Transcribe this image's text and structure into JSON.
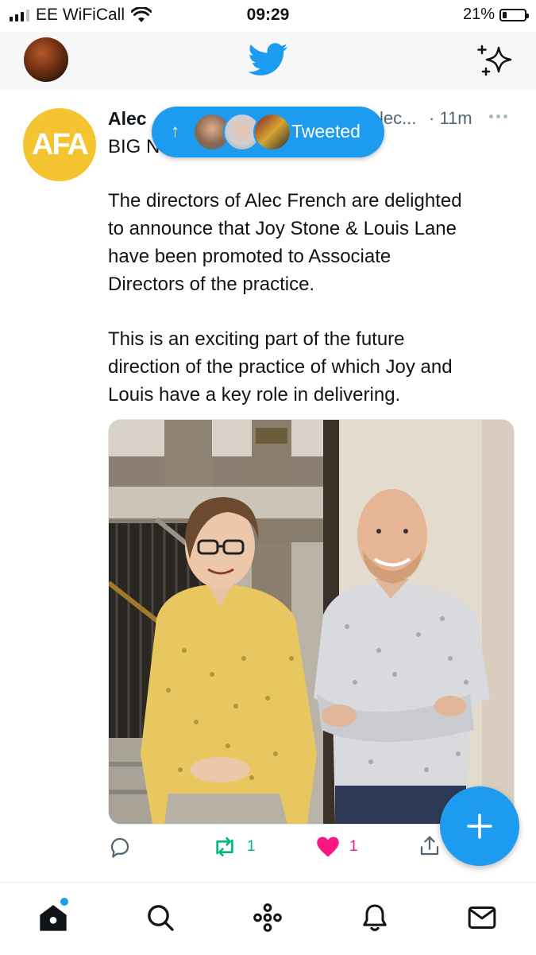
{
  "status_bar": {
    "carrier": "EE WiFiCall",
    "time": "09:29",
    "battery": "21%",
    "battery_level": 0.21
  },
  "header": {
    "logo_icon": "twitter-bird-icon",
    "sparkle_icon": "sparkle-icon",
    "profile_avatar_icon": "profile-avatar"
  },
  "tweet": {
    "author_name_visible": "Alec",
    "handle_visible": "lec...",
    "time": "· 11m",
    "avatar_text": "AFA",
    "avatar_color": "#F4C430",
    "first_line_visible": "BIG N",
    "text_lines": [
      "The directors of Alec French are delighted",
      "to announce that Joy Stone & Louis Lane",
      "have been promoted to Associate",
      "Directors of the practice.",
      "",
      "This is an exciting part of the future",
      "direction of the practice of which Joy and",
      "Louis have a key role in delivering."
    ],
    "actions": {
      "reply_count": "",
      "retweet_count": "1",
      "like_count": "1"
    }
  },
  "tweeted_pill": {
    "label": "Tweeted",
    "arrow": "↑"
  },
  "colors": {
    "twitter_blue": "#1D9BF0",
    "retweet_green": "#00BA7C",
    "like_pink": "#F91880",
    "text": "#0F1419",
    "secondary_text": "#536471"
  },
  "tab_bar": {
    "tabs": [
      "home-icon",
      "search-icon",
      "spaces-icon",
      "notifications-icon",
      "messages-icon"
    ]
  }
}
